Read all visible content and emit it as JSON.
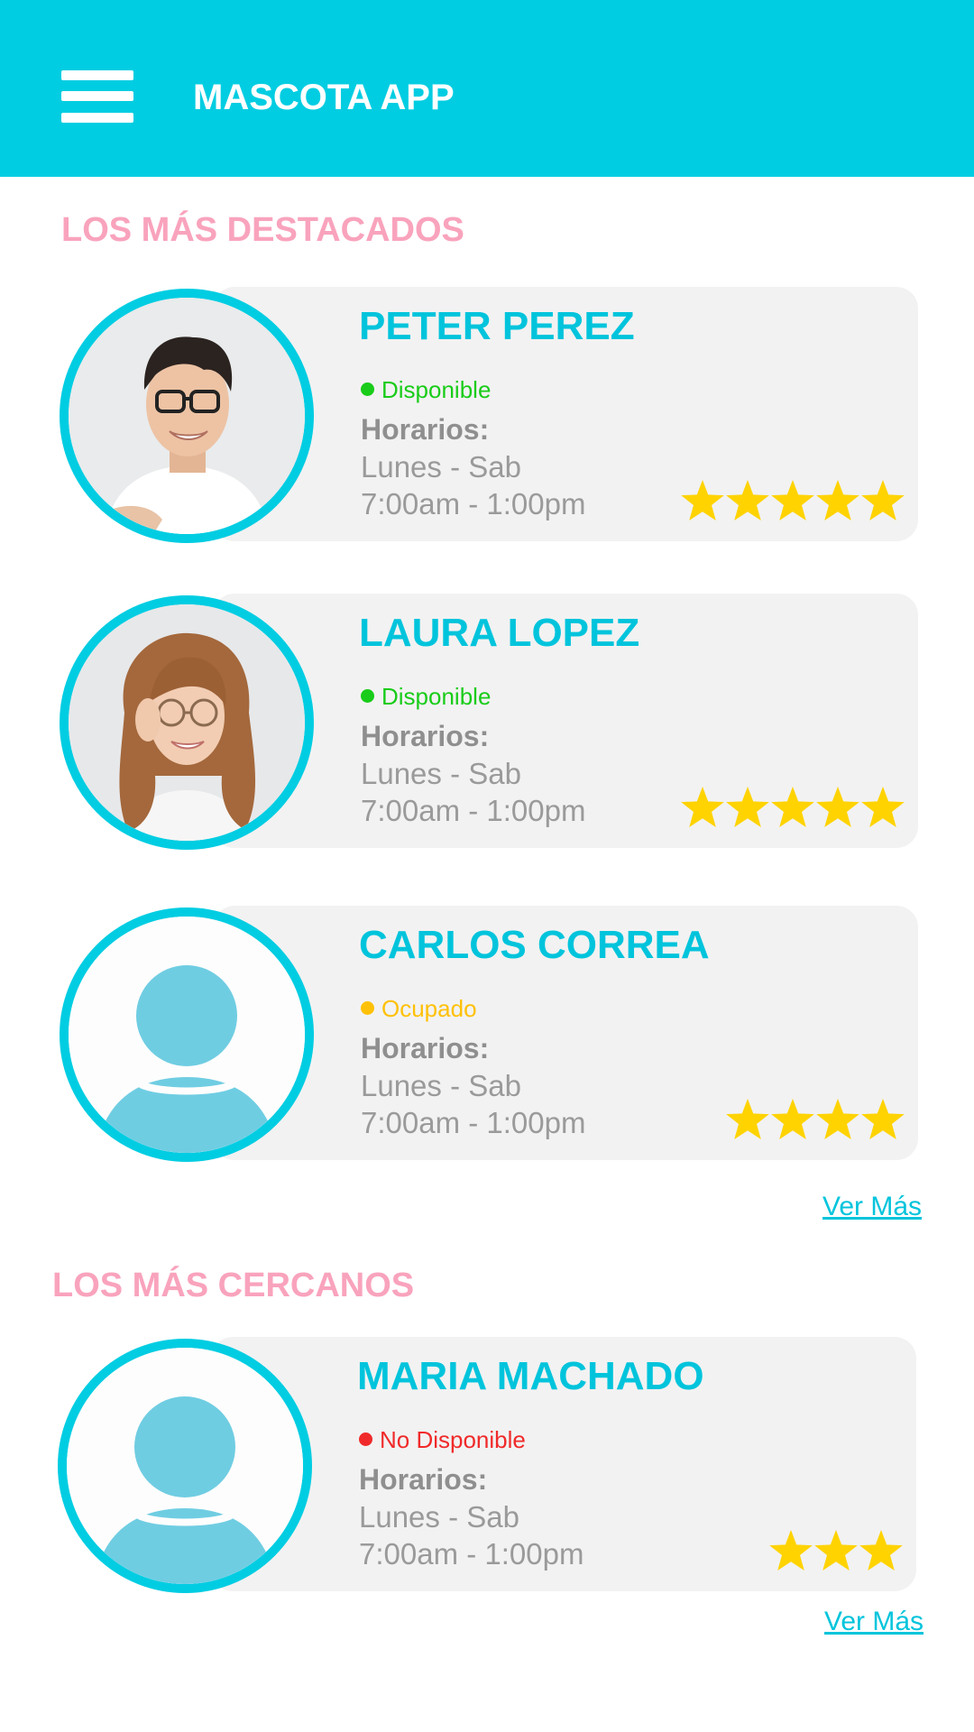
{
  "header": {
    "title": "MASCOTA APP",
    "background": "#00cde2",
    "menu_icon": "hamburger-menu-icon"
  },
  "sections": [
    {
      "title": "LOS MÁS DESTACADOS",
      "cards": [
        {
          "name": "PETER PEREZ",
          "status": "Disponible",
          "status_color": "#19cc19",
          "schedule_label": "Horarios:",
          "days": "Lunes - Sab",
          "hours": "7:00am - 1:00pm",
          "rating": 5,
          "avatar": "man-with-glasses-photo"
        },
        {
          "name": "LAURA LOPEZ",
          "status": "Disponible",
          "status_color": "#19cc19",
          "schedule_label": "Horarios:",
          "days": "Lunes - Sab",
          "hours": "7:00am - 1:00pm",
          "rating": 5,
          "avatar": "woman-with-glasses-photo"
        },
        {
          "name": "CARLOS CORREA",
          "status": "Ocupado",
          "status_color": "#ffc107",
          "schedule_label": "Horarios:",
          "days": "Lunes - Sab",
          "hours": "7:00am - 1:00pm",
          "rating": 4,
          "avatar": "default-user-icon"
        }
      ],
      "more_link": "Ver Más"
    },
    {
      "title": "LOS MÁS CERCANOS",
      "cards": [
        {
          "name": "MARIA MACHADO",
          "status": "No Disponible",
          "status_color": "#f02a2a",
          "schedule_label": "Horarios:",
          "days": "Lunes - Sab",
          "hours": "7:00am - 1:00pm",
          "rating": 3,
          "avatar": "default-user-icon"
        }
      ],
      "more_link": "Ver Más"
    }
  ],
  "colors": {
    "accent": "#00cde2",
    "section_title": "#f9a3bd",
    "star": "#ffd300",
    "card_bg": "#f2f2f2",
    "avatar_placeholder": "#6fcde2"
  }
}
